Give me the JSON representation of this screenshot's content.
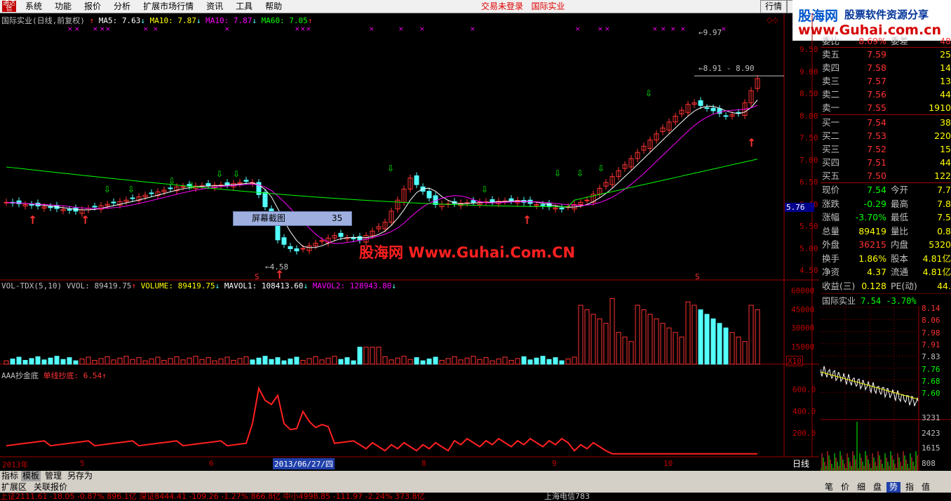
{
  "menu": {
    "items": [
      "系统",
      "功能",
      "报价",
      "分析",
      "扩展市场行情",
      "资讯",
      "工具",
      "帮助"
    ],
    "alert_login": "交易未登录",
    "alert_stock": "国际实业",
    "btn_quote": "行情"
  },
  "brand": {
    "name": "股海网",
    "slogan": "股票软件资源分享",
    "url": "www.Guhai.com.cn"
  },
  "main_chart": {
    "header": "国际实业(日线,前复权)",
    "ma5": "MA5: 7.63",
    "ma10": "MA10: 7.87",
    "ma10b": "MA10: 7.87",
    "ma60": "MA60: 7.05",
    "ylabels": [
      "9.50",
      "9.00",
      "8.50",
      "8.00",
      "7.50",
      "7.00",
      "6.50",
      "6.00",
      "5.50",
      "5.00",
      "4.50"
    ],
    "ylabel_current": "5.76",
    "label_high": "9.97",
    "label_high2": "8.91 - 8.90",
    "label_low": "4.58",
    "watermark": "股海网 Www.Guhai.Com.CN",
    "tooltip_label": "屏幕截图",
    "tooltip_value": "35",
    "s_mark": "S"
  },
  "vol_chart": {
    "title": "VOL-TDX(5,10)",
    "vvol": "VVOL: 89419.75",
    "volume": "VOLUME: 89419.75",
    "mavol1": "MAVOL1: 108413.60",
    "mavol2": "MAVOL2: 128943.80",
    "ylabels": [
      "60000",
      "45000",
      "30000",
      "15000"
    ],
    "unit": "X10"
  },
  "ind_chart": {
    "title": "AAA抄金底",
    "value": "单线抄底: 6.54",
    "ylabels": [
      "600.0",
      "400.0",
      "200.0"
    ]
  },
  "date_axis": {
    "labels": [
      "2013年",
      "5",
      "6",
      "8",
      "9",
      "10"
    ],
    "cursor": "2013/06/27/四",
    "right": "日线"
  },
  "quote": {
    "top_row": {
      "l": "委比",
      "p": "8.69%",
      "l2": "委差",
      "v": "48"
    },
    "sells": [
      {
        "l": "卖五",
        "p": "7.59",
        "v": "25"
      },
      {
        "l": "卖四",
        "p": "7.58",
        "v": "14"
      },
      {
        "l": "卖三",
        "p": "7.57",
        "v": "13"
      },
      {
        "l": "卖二",
        "p": "7.56",
        "v": "44"
      },
      {
        "l": "卖一",
        "p": "7.55",
        "v": "1910"
      }
    ],
    "buys": [
      {
        "l": "买一",
        "p": "7.54",
        "v": "38"
      },
      {
        "l": "买二",
        "p": "7.53",
        "v": "220"
      },
      {
        "l": "买三",
        "p": "7.52",
        "v": "15"
      },
      {
        "l": "买四",
        "p": "7.51",
        "v": "44"
      },
      {
        "l": "买五",
        "p": "7.50",
        "v": "122"
      }
    ],
    "stats": [
      {
        "l": "现价",
        "p": "7.54",
        "l2": "今开",
        "v": "7.7"
      },
      {
        "l": "涨跌",
        "p": "-0.29",
        "l2": "最高",
        "v": "7.8"
      },
      {
        "l": "涨幅",
        "p": "-3.70%",
        "l2": "最低",
        "v": "7.5"
      },
      {
        "l": "总量",
        "p": "89419",
        "l2": "量比",
        "v": "0.8"
      },
      {
        "l": "外盘",
        "p": "36215",
        "l2": "内盘",
        "v": "5320"
      },
      {
        "l": "换手",
        "p": "1.86%",
        "l2": "股本",
        "v": "4.81亿"
      },
      {
        "l": "净资",
        "p": "4.37",
        "l2": "流通",
        "v": "4.81亿"
      },
      {
        "l": "收益(三)",
        "p": "0.128",
        "l2": "PE(动)",
        "v": "44."
      }
    ]
  },
  "minichart": {
    "title": "国际实业",
    "price": "7.54 -3.70%",
    "ylabels": [
      "8.14",
      "8.06",
      "7.98",
      "7.91",
      "7.83",
      "7.76",
      "7.68",
      "7.60"
    ],
    "vlabels": [
      "3231",
      "2423",
      "1615",
      "808"
    ]
  },
  "bottom": {
    "tabs": [
      "指标",
      "模板",
      "管理",
      "另存为"
    ],
    "tabs2": [
      "扩展区",
      "关联报价"
    ],
    "rtabs": [
      "笔",
      "价",
      "细",
      "盘",
      "势",
      "指",
      "值"
    ],
    "ticker": "上证2111.61  -18.05  -0.87%  896.1亿  深证8444.41  -109.26  -1.27%  866.8亿  中小4998.85  -111.97  -2.24%  373.8亿",
    "ticker_right": "上海电信783"
  },
  "colors": {
    "up": "#ff3232",
    "down": "#54ffff",
    "ma5": "#ffffff",
    "ma10": "#ff00ff",
    "ma60": "#00ff00",
    "grid": "#a00000"
  }
}
